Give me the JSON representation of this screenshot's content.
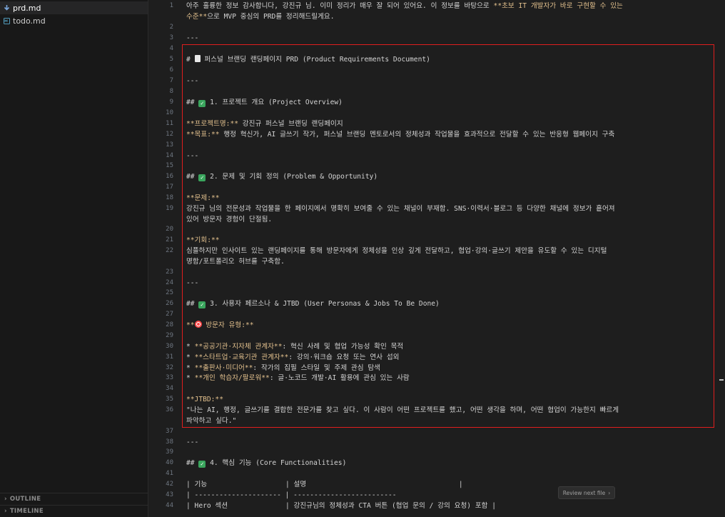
{
  "sidebar": {
    "files": [
      {
        "name": "prd.md",
        "icon": "download-arrow-icon",
        "active": true
      },
      {
        "name": "todo.md",
        "icon": "markdown-file-icon",
        "active": false
      }
    ],
    "sections": [
      "OUTLINE",
      "TIMELINE"
    ]
  },
  "editor": {
    "lines": {
      "l1a": "아주 훌륭한 정보 감사합니다, 강진규 님. 이미 정리가 매우 잘 되어 있어요. 이 정보를 바탕으로 ",
      "l1b": "**초보 IT 개발자가 바로 구현할 수 있는",
      "l1c": "수준**",
      "l1d": "으로 MVP 중심의 PRD를 정리해드릴게요.",
      "l3": "---",
      "l5": "# ",
      "l5b": " 퍼스널 브랜딩 랜딩페이지 PRD (Product Requirements Document)",
      "l7": "---",
      "l9a": "## ",
      "l9b": " 1. 프로젝트 개요 (Project Overview)",
      "l11a": "**프로젝트명:**",
      "l11b": " 강진규 퍼스널 브랜딩 랜딩페이지",
      "l12a": "**목표:**",
      "l12b": " 행정 혁신가, AI 글쓰기 작가, 퍼스널 브랜딩 멘토로서의 정체성과 작업물을 효과적으로 전달할 수 있는 반응형 웹페이지 구축",
      "l14": "---",
      "l16a": "## ",
      "l16b": " 2. 문제 및 기회 정의 (Problem & Opportunity)",
      "l18": "**문제:**",
      "l19a": "강진규 님의 전문성과 작업물을 한 페이지에서 명확히 보여줄 수 있는 채널이 부재함. SNS·이력서·블로그 등 다양한 채널에 정보가 흩어져",
      "l19b": "있어 방문자 경험이 단절됨.",
      "l21": "**기회:**",
      "l22a": "심플하지만 인사이트 있는 랜딩페이지를 통해 방문자에게 정체성을 인상 깊게 전달하고, 협업·강의·글쓰기 제안을 유도할 수 있는 디지털",
      "l22b": "명함/포트폴리오 허브를 구축함.",
      "l24": "---",
      "l26a": "## ",
      "l26b": " 3. 사용자 페르소나 & JTBD (User Personas & Jobs To Be Done)",
      "l28a": "**",
      "l28b": " 방문자 유형:**",
      "l30a": "* ",
      "l30b": "**공공기관·지자체 관계자**",
      "l30c": ": 혁신 사례 및 협업 가능성 확인 목적",
      "l31a": "* ",
      "l31b": "**스타트업·교육기관 관계자**",
      "l31c": ": 강의·워크숍 요청 또는 연사 섭외",
      "l32a": "* ",
      "l32b": "**출판사·미디어**",
      "l32c": ": 작가의 집필 스타일 및 주제 관심 탐색",
      "l33a": "* ",
      "l33b": "**개인 학습자/팔로워**",
      "l33c": ": 글·노코드 개발·AI 활용에 관심 있는 사람",
      "l35": "**JTBD:**",
      "l36a": "\"나는 AI, 행정, 글쓰기를 결합한 전문가를 찾고 싶다. 이 사람이 어떤 프로젝트를 했고, 어떤 생각을 하며, 어떤 협업이 가능한지 빠르게",
      "l36b": "파악하고 싶다.\"",
      "l38": "---",
      "l40a": "## ",
      "l40b": " 4. 핵심 기능 (Core Functionalities)",
      "l42": "| 기능                   | 설명                                     |",
      "l43": "| --------------------- | -------------------------",
      "l44": "| Hero 섹션              | 강진규님의 정체성과 CTA 버튼 (협업 문의 / 강의 요청) 포함 |"
    },
    "numbers": [
      "1",
      "",
      "2",
      "3",
      "4",
      "5",
      "6",
      "7",
      "8",
      "9",
      "10",
      "11",
      "12",
      "13",
      "14",
      "15",
      "16",
      "17",
      "18",
      "19",
      "",
      "20",
      "21",
      "22",
      "",
      "23",
      "24",
      "25",
      "26",
      "27",
      "28",
      "29",
      "30",
      "31",
      "32",
      "33",
      "34",
      "35",
      "36",
      "",
      "37",
      "38",
      "39",
      "40",
      "41",
      "42",
      "43",
      "44"
    ]
  },
  "review": {
    "label": "Review next file",
    "chevron": "›"
  }
}
